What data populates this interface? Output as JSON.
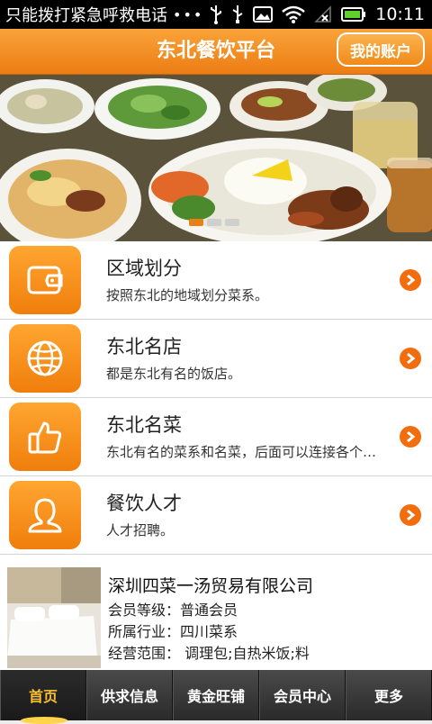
{
  "status_bar": {
    "notice": "只能拨打紧急呼救电话",
    "dots": "•••",
    "time": "10:11"
  },
  "header": {
    "title": "东北餐饮平台",
    "account_button": "我的账户"
  },
  "banner": {
    "slide_count": 3,
    "active_slide": 1
  },
  "menu_items": [
    {
      "title": "区域划分",
      "desc": "按照东北的地域划分菜系。",
      "icon": "wallet-icon"
    },
    {
      "title": "东北名店",
      "desc": "都是东北有名的饭店。",
      "icon": "globe-icon"
    },
    {
      "title": "东北名菜",
      "desc": "东北有名的菜系和名菜，后面可以连接各个菜系",
      "icon": "thumbs-up-icon"
    },
    {
      "title": "餐饮人才",
      "desc": "人才招聘。",
      "icon": "user-icon"
    }
  ],
  "company": {
    "name": "深圳四菜一汤贸易有限公司",
    "level": "会员等级：普通会员",
    "industry": "所属行业：四川菜系",
    "scope": "经营范围： 调理包;自热米饭;料"
  },
  "tabs": [
    {
      "label": "首页",
      "active": true
    },
    {
      "label": "供求信息",
      "active": false
    },
    {
      "label": "黄金旺铺",
      "active": false
    },
    {
      "label": "会员中心",
      "active": false
    },
    {
      "label": "更多",
      "active": false
    }
  ],
  "colors": {
    "accent": "#f08b19",
    "status_bar": "#000000",
    "tab_active": "#f8c030"
  }
}
